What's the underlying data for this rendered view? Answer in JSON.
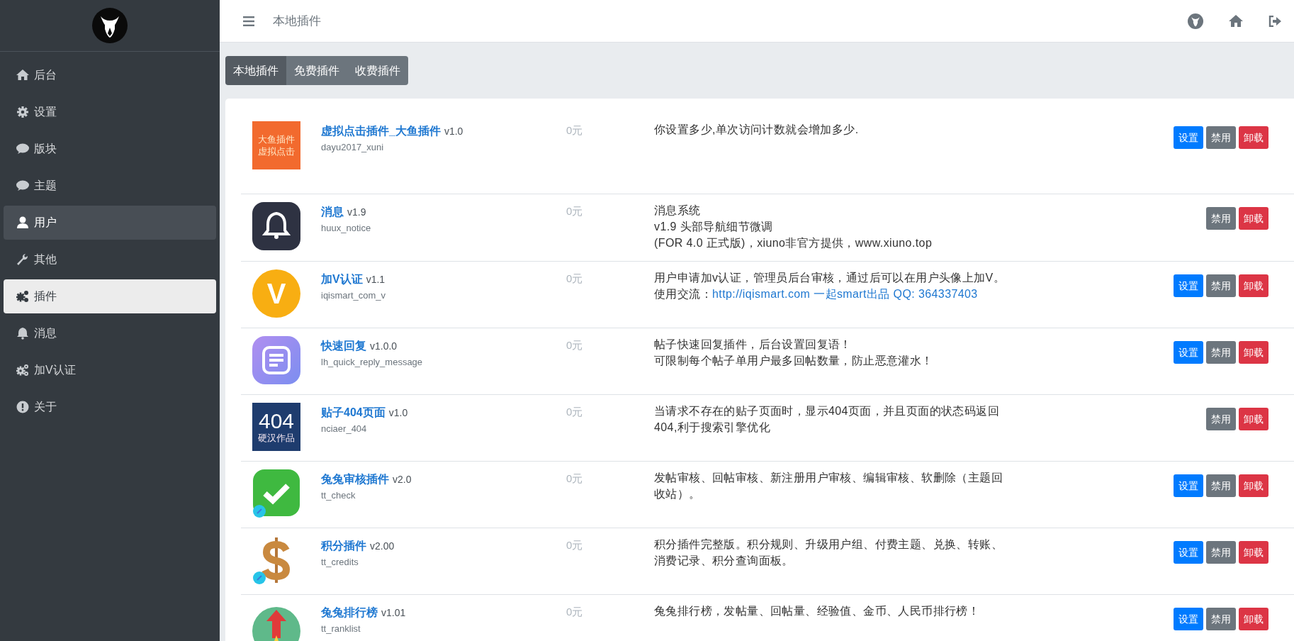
{
  "sidebar": {
    "items": [
      {
        "kind": "home",
        "label": "后台",
        "selected": false,
        "hovered": false
      },
      {
        "kind": "gear",
        "label": "设置",
        "selected": false,
        "hovered": false
      },
      {
        "kind": "comment",
        "label": "版块",
        "selected": false,
        "hovered": false
      },
      {
        "kind": "comment",
        "label": "主题",
        "selected": false,
        "hovered": false
      },
      {
        "kind": "user",
        "label": "用户",
        "selected": false,
        "hovered": true
      },
      {
        "kind": "wrench",
        "label": "其他",
        "selected": false,
        "hovered": false
      },
      {
        "kind": "gears",
        "label": "插件",
        "selected": true,
        "hovered": false
      },
      {
        "kind": "bell",
        "label": "消息",
        "selected": false,
        "hovered": false
      },
      {
        "kind": "gears",
        "label": "加V认证",
        "selected": false,
        "hovered": false
      },
      {
        "kind": "info",
        "label": "关于",
        "selected": false,
        "hovered": false
      }
    ]
  },
  "header": {
    "title": "本地插件"
  },
  "tabs": [
    {
      "label": "本地插件",
      "selected": true
    },
    {
      "label": "免费插件",
      "selected": false
    },
    {
      "label": "收费插件",
      "selected": false
    }
  ],
  "plugins": [
    {
      "icon": {
        "kind": "tile",
        "lines": [
          "大鱼插件",
          "虚拟点击"
        ]
      },
      "name": "虚拟点击插件_大鱼插件",
      "version": "v1.0",
      "slug": "dayu2017_xuni",
      "price": "0元",
      "description": [
        "你设置多少,单次访问计数就会增加多少."
      ],
      "buttons": [
        {
          "kind": "settings",
          "label": "设置"
        },
        {
          "kind": "disable",
          "label": "禁用"
        },
        {
          "kind": "uninstall",
          "label": "卸载"
        }
      ]
    },
    {
      "icon": {
        "kind": "bell"
      },
      "name": "消息",
      "version": "v1.9",
      "slug": "huux_notice",
      "price": "0元",
      "description": [
        "消息系统",
        "v1.9 头部导航细节微调",
        "(FOR 4.0 正式版)，xiuno非官方提供，www.xiuno.top"
      ],
      "buttons": [
        {
          "kind": "disable",
          "label": "禁用"
        },
        {
          "kind": "uninstall",
          "label": "卸载"
        }
      ]
    },
    {
      "icon": {
        "kind": "letter",
        "lines": [
          "V"
        ]
      },
      "name": "加V认证",
      "version": "v1.1",
      "slug": "iqismart_com_v",
      "price": "0元",
      "description": [
        "用户申请加v认证，管理员后台审核，通过后可以在用户头像上加V。使用交流："
      ],
      "link": "http://iqismart.com 一起smart出品 QQ: 364337403",
      "buttons": [
        {
          "kind": "settings",
          "label": "设置"
        },
        {
          "kind": "disable",
          "label": "禁用"
        },
        {
          "kind": "uninstall",
          "label": "卸载"
        }
      ]
    },
    {
      "icon": {
        "kind": "list"
      },
      "name": "快速回复",
      "version": "v1.0.0",
      "slug": "lh_quick_reply_message",
      "price": "0元",
      "description": [
        "帖子快速回复插件，后台设置回复语！",
        "可限制每个帖子单用户最多回帖数量，防止恶意灌水！"
      ],
      "buttons": [
        {
          "kind": "settings",
          "label": "设置"
        },
        {
          "kind": "disable",
          "label": "禁用"
        },
        {
          "kind": "uninstall",
          "label": "卸载"
        }
      ]
    },
    {
      "icon": {
        "kind": "code-tile",
        "lines": [
          "404",
          "硬汉作品"
        ]
      },
      "name": "贴子404页面",
      "version": "v1.0",
      "slug": "nciaer_404",
      "price": "0元",
      "description": [
        "当请求不存在的贴子页面时，显示404页面，并且页面的状态码返回404,利于搜索引擎优化"
      ],
      "buttons": [
        {
          "kind": "disable",
          "label": "禁用"
        },
        {
          "kind": "uninstall",
          "label": "卸载"
        }
      ]
    },
    {
      "icon": {
        "kind": "check"
      },
      "name": "兔兔审核插件",
      "version": "v2.0",
      "slug": "tt_check",
      "price": "0元",
      "description": [
        "发帖审核、回帖审核、新注册用户审核、编辑审核、软删除（主题回收站）。"
      ],
      "buttons": [
        {
          "kind": "settings",
          "label": "设置"
        },
        {
          "kind": "disable",
          "label": "禁用"
        },
        {
          "kind": "uninstall",
          "label": "卸载"
        }
      ]
    },
    {
      "icon": {
        "kind": "dollar"
      },
      "name": "积分插件",
      "version": "v2.00",
      "slug": "tt_credits",
      "price": "0元",
      "description": [
        "积分插件完整版。积分规则、升级用户组、付费主题、兑换、转账、消费记录、积分查询面板。"
      ],
      "buttons": [
        {
          "kind": "settings",
          "label": "设置"
        },
        {
          "kind": "disable",
          "label": "禁用"
        },
        {
          "kind": "uninstall",
          "label": "卸载"
        }
      ]
    },
    {
      "icon": {
        "kind": "rank"
      },
      "name": "兔兔排行榜",
      "version": "v1.01",
      "slug": "tt_ranklist",
      "price": "0元",
      "description": [
        "兔兔排行榜，发帖量、回帖量、经验值、金币、人民币排行榜！"
      ],
      "buttons": [
        {
          "kind": "settings",
          "label": "设置"
        },
        {
          "kind": "disable",
          "label": "禁用"
        },
        {
          "kind": "uninstall",
          "label": "卸载"
        }
      ]
    }
  ]
}
